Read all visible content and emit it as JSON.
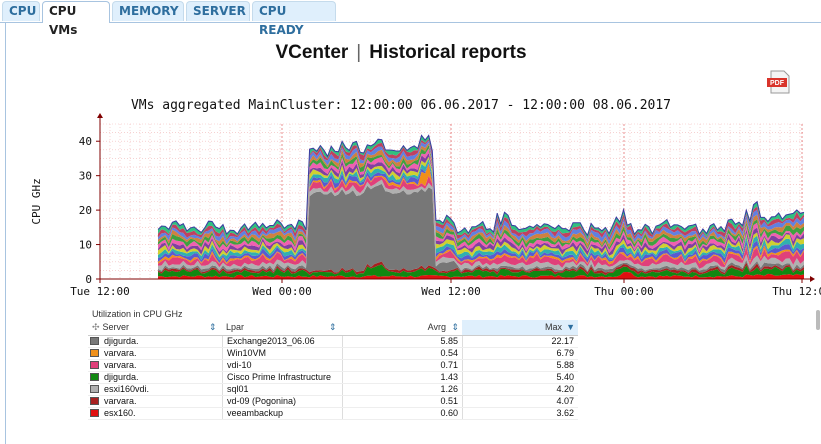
{
  "tabs": [
    {
      "label": "CPU",
      "active": false
    },
    {
      "label": "CPU VMs",
      "active": true
    },
    {
      "label": "MEMORY",
      "active": false
    },
    {
      "label": "SERVER",
      "active": false
    },
    {
      "label": "CPU READY",
      "active": false
    }
  ],
  "header": {
    "app": "VCenter",
    "separator": "|",
    "page": "Historical reports"
  },
  "pdf_icon": {
    "label": "PDF",
    "color": "#d9342b"
  },
  "chart_data": {
    "type": "area",
    "title": "VMs aggregated  MainCluster: 12:00:00 06.06.2017 - 12:00:00 08.06.2017",
    "ylabel": "CPU GHz",
    "xlabel": "",
    "ylim": [
      0,
      45
    ],
    "yticks": [
      0,
      10,
      20,
      30,
      40
    ],
    "xticks": [
      "Tue 12:00",
      "Wed 00:00",
      "Wed 12:00",
      "Thu 00:00",
      "Thu 12:00"
    ],
    "grid": true,
    "description_series": [
      {
        "name": "Exchange2013_06.06",
        "color": "#777777",
        "avg": 5.85,
        "max": 22.17
      },
      {
        "name": "Win10VM",
        "color": "#f0901a",
        "avg": 0.54,
        "max": 6.79
      },
      {
        "name": "vdi-10",
        "color": "#e0407a",
        "avg": 0.71,
        "max": 5.88
      },
      {
        "name": "Cisco Prime Infrastructure",
        "color": "#118811",
        "avg": 1.43,
        "max": 5.4
      },
      {
        "name": "sql01",
        "color": "#b0b0b0",
        "avg": 1.26,
        "max": 4.2
      },
      {
        "name": "vd-09 (Pogonina)",
        "color": "#a82020",
        "avg": 0.51,
        "max": 4.07
      },
      {
        "name": "veeambackup",
        "color": "#e01010",
        "avg": 0.6,
        "max": 3.62
      }
    ]
  },
  "table": {
    "caption": "Utilization in CPU GHz",
    "columns": {
      "server": "Server",
      "lpar": "Lpar",
      "avrg": "Avrg",
      "max": "Max"
    },
    "rows": [
      {
        "color": "#777777",
        "server": "djigurda.",
        "lpar": "Exchange2013_06.06",
        "avrg": "5.85",
        "max": "22.17"
      },
      {
        "color": "#f0901a",
        "server": "varvara.",
        "lpar": "Win10VM",
        "avrg": "0.54",
        "max": "6.79"
      },
      {
        "color": "#e0407a",
        "server": "varvara.",
        "lpar": "vdi-10",
        "avrg": "0.71",
        "max": "5.88"
      },
      {
        "color": "#118811",
        "server": "djigurda.",
        "lpar": "Cisco Prime Infrastructure",
        "avrg": "1.43",
        "max": "5.40"
      },
      {
        "color": "#b0b0b0",
        "server": "esxi160vdi.",
        "lpar": "sql01",
        "avrg": "1.26",
        "max": "4.20"
      },
      {
        "color": "#a82020",
        "server": "varvara.",
        "lpar": "vd-09 (Pogonina)",
        "avrg": "0.51",
        "max": "4.07"
      },
      {
        "color": "#e01010",
        "server": "esx160.",
        "lpar": "veeambackup",
        "avrg": "0.60",
        "max": "3.62"
      }
    ]
  }
}
